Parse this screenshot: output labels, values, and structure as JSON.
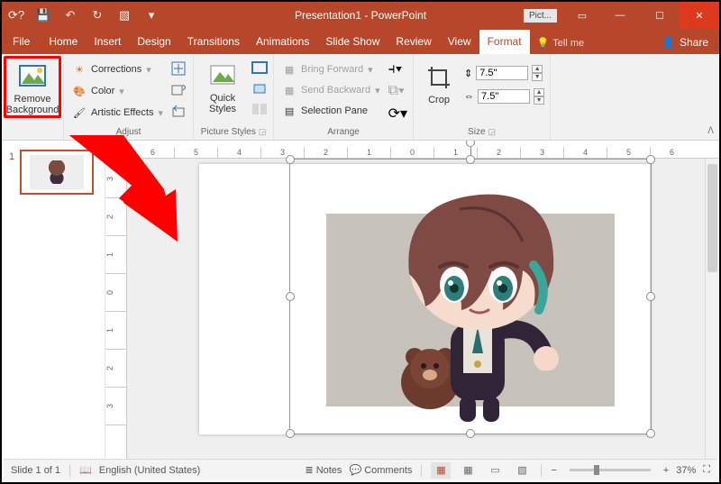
{
  "titlebar": {
    "title": "Presentation1 - PowerPoint",
    "context_label": "Pict..."
  },
  "tabs": {
    "file": "File",
    "home": "Home",
    "insert": "Insert",
    "design": "Design",
    "transitions": "Transitions",
    "animations": "Animations",
    "slideshow": "Slide Show",
    "review": "Review",
    "view": "View",
    "format": "Format",
    "tellme": "Tell me",
    "share": "Share"
  },
  "ribbon": {
    "remove_bg": "Remove\nBackground",
    "corrections": "Corrections",
    "color": "Color",
    "artistic": "Artistic Effects",
    "adjust_label": "Adjust",
    "quick_styles": "Quick\nStyles",
    "picstyles_label": "Picture Styles",
    "bring_forward": "Bring Forward",
    "send_backward": "Send Backward",
    "selection_pane": "Selection Pane",
    "arrange_label": "Arrange",
    "crop": "Crop",
    "size_h": "7.5\"",
    "size_w": "7.5\"",
    "size_label": "Size"
  },
  "ruler_h": [
    "6",
    "5",
    "4",
    "3",
    "2",
    "1",
    "0",
    "1",
    "2",
    "3",
    "4",
    "5",
    "6"
  ],
  "ruler_v": [
    "3",
    "2",
    "1",
    "0",
    "1",
    "2",
    "3"
  ],
  "thumbs": {
    "n1": "1"
  },
  "status": {
    "slide": "Slide 1 of 1",
    "lang": "English (United States)",
    "notes": "Notes",
    "comments": "Comments",
    "zoom": "37%",
    "minus": "−",
    "plus": "+"
  }
}
